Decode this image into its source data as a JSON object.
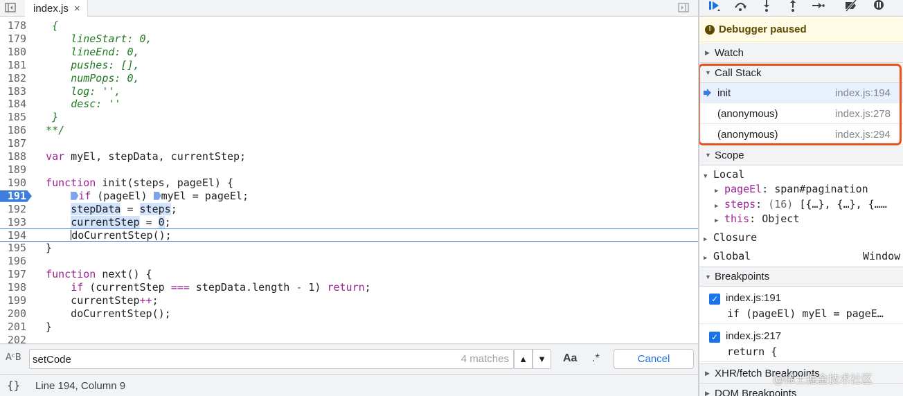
{
  "editor": {
    "tab": {
      "label": "index.js",
      "close": "×"
    },
    "lines": [
      {
        "n": "178",
        "html": "   <span class=\"cm\">{</span>"
      },
      {
        "n": "179",
        "html": "      <span class=\"cm\">lineStart: 0,</span>"
      },
      {
        "n": "180",
        "html": "      <span class=\"cm\">lineEnd: 0,</span>"
      },
      {
        "n": "181",
        "html": "      <span class=\"cm\">pushes: [],</span>"
      },
      {
        "n": "182",
        "html": "      <span class=\"cm\">numPops: 0,</span>"
      },
      {
        "n": "183",
        "html": "      <span class=\"cm\">log: '',</span>"
      },
      {
        "n": "184",
        "html": "      <span class=\"cm\">desc: ''</span>"
      },
      {
        "n": "185",
        "html": "   <span class=\"cm\">}</span>"
      },
      {
        "n": "186",
        "html": "  <span class=\"cm\">**/</span>"
      },
      {
        "n": "187",
        "html": ""
      },
      {
        "n": "188",
        "html": "  <span class=\"k\">var</span> myEl, stepData, currentStep;"
      },
      {
        "n": "189",
        "html": ""
      },
      {
        "n": "190",
        "html": "  <span class=\"k\">function</span> init(steps, pageEl) {"
      },
      {
        "n": "191",
        "html": "      <span class=\"inline-bp\"></span><span class=\"k\">if</span> (pageEl) <span class=\"inline-bp\"></span>myEl = pageEl;",
        "breakpoint": true
      },
      {
        "n": "192",
        "html": "      <span class=\"hl\">stepData</span> = <span class=\"hl\">steps</span>;"
      },
      {
        "n": "193",
        "html": "      <span class=\"hl\">currentStep</span> = <span class=\"hl\">0</span>;"
      },
      {
        "n": "194",
        "html": "      <span class=\"caret\"></span>doCurrentStep();",
        "current": true
      },
      {
        "n": "195",
        "html": "  }"
      },
      {
        "n": "196",
        "html": ""
      },
      {
        "n": "197",
        "html": "  <span class=\"k\">function</span> next() {"
      },
      {
        "n": "198",
        "html": "      <span class=\"k\">if</span> (currentStep <span class=\"k\">===</span> stepData.length <span class=\"k\">-</span> 1) <span class=\"k\">return</span>;"
      },
      {
        "n": "199",
        "html": "      currentStep<span class=\"k\">++</span>;"
      },
      {
        "n": "200",
        "html": "      doCurrentStep();"
      },
      {
        "n": "201",
        "html": "  }"
      },
      {
        "n": "202",
        "html": ""
      }
    ]
  },
  "search": {
    "regex_toggle": "AᶜB",
    "value": "setCode",
    "matches": "4 matches",
    "prev": "▲",
    "next": "▼",
    "match_case": "Aa",
    "regex": ".*",
    "cancel": "Cancel"
  },
  "status": {
    "format_icon": "{}",
    "cursor": "Line 194, Column 9"
  },
  "debugger": {
    "paused_icon": "!",
    "paused": "Debugger paused",
    "sections": {
      "watch": "Watch",
      "call_stack": "Call Stack",
      "scope": "Scope",
      "breakpoints": "Breakpoints",
      "xhr": "XHR/fetch Breakpoints",
      "dom": "DOM Breakpoints"
    },
    "call_stack": [
      {
        "name": "init",
        "loc": "index.js:194"
      },
      {
        "name": "(anonymous)",
        "loc": "index.js:278"
      },
      {
        "name": "(anonymous)",
        "loc": "index.js:294"
      }
    ],
    "scope": {
      "local": "Local",
      "vars": [
        {
          "key": "pageEl",
          "sep": ": ",
          "val": "span#pagination"
        },
        {
          "key": "steps",
          "sep": ": ",
          "dim": "(16) ",
          "val": "[{…}, {…}, {……"
        },
        {
          "key": "this",
          "sep": ": ",
          "val": "Object"
        }
      ],
      "closure": "Closure",
      "global": "Global",
      "global_val": "Window"
    },
    "breakpoints": [
      {
        "loc": "index.js:191",
        "code": "if (pageEl) myEl = pageE…",
        "checked": "✓"
      },
      {
        "loc": "index.js:217",
        "code": "return {",
        "checked": "✓"
      }
    ]
  },
  "watermark": "@稀土掘金技术社区",
  "colors": {
    "accent": "#1a73e8",
    "highlight": "#e8501e",
    "breakpoint": "#3d7ddb"
  }
}
